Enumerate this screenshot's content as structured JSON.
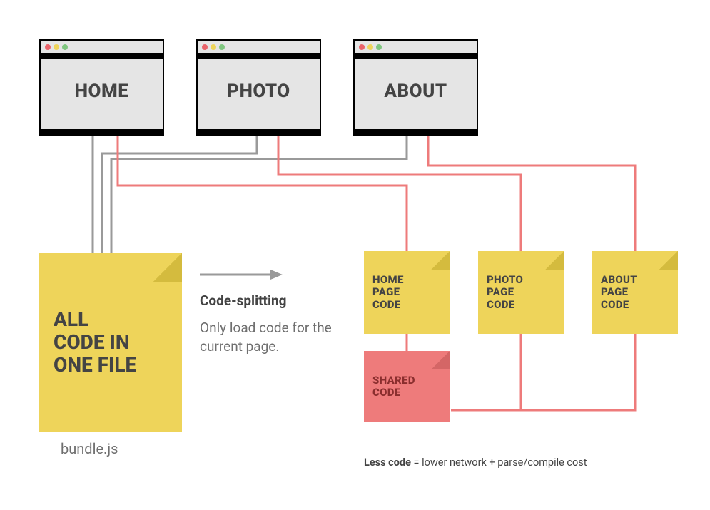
{
  "windows": {
    "home": "HOME",
    "photo": "PHOTO",
    "about": "ABOUT"
  },
  "bundle": {
    "label": "ALL\nCODE IN\nONE FILE",
    "filename": "bundle.js"
  },
  "middle": {
    "heading": "Code-splitting",
    "body": "Only load code for the current page."
  },
  "splits": {
    "home": "HOME\nPAGE\nCODE",
    "photo": "PHOTO\nPAGE\nCODE",
    "about": "ABOUT\nPAGE\nCODE",
    "shared": "SHARED\nCODE"
  },
  "bottom_note": {
    "strong": "Less code",
    "rest": " = lower network + parse/compile cost"
  }
}
